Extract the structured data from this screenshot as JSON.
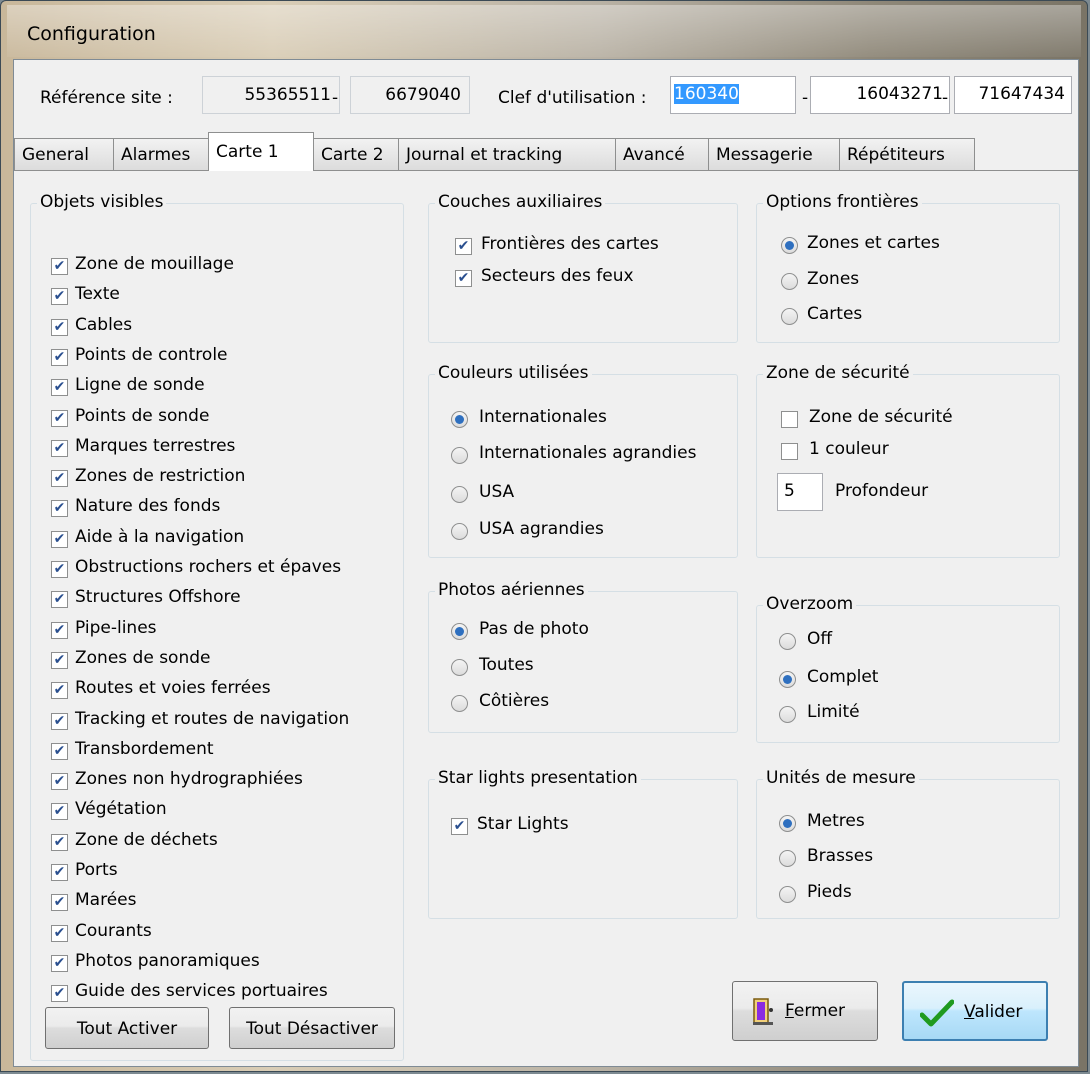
{
  "window": {
    "title": "Configuration"
  },
  "site": {
    "reference_label": "Référence site :",
    "reference_1": "55365511",
    "sep1": "-",
    "reference_2": "6679040",
    "key_label": "Clef d'utilisation :",
    "key_1": "160340",
    "sep2": "-",
    "key_2": "16043271",
    "sep3": "-",
    "key_3": "71647434"
  },
  "tabs": [
    {
      "label": "General"
    },
    {
      "label": "Alarmes"
    },
    {
      "label": "Carte 1"
    },
    {
      "label": "Carte 2"
    },
    {
      "label": "Journal et tracking"
    },
    {
      "label": "Avancé"
    },
    {
      "label": "Messagerie"
    },
    {
      "label": "Répétiteurs"
    }
  ],
  "active_tab": "Carte 1",
  "visible_objects": {
    "title": "Objets visibles",
    "items": [
      {
        "label": "Zone de mouillage",
        "checked": true
      },
      {
        "label": "Texte",
        "checked": true
      },
      {
        "label": "Cables",
        "checked": true
      },
      {
        "label": "Points de controle",
        "checked": true
      },
      {
        "label": "Ligne de sonde",
        "checked": true
      },
      {
        "label": "Points de sonde",
        "checked": true
      },
      {
        "label": "Marques terrestres",
        "checked": true
      },
      {
        "label": "Zones de restriction",
        "checked": true
      },
      {
        "label": "Nature des fonds",
        "checked": true
      },
      {
        "label": "Aide à la navigation",
        "checked": true
      },
      {
        "label": "Obstructions  rochers et épaves",
        "checked": true
      },
      {
        "label": "Structures Offshore",
        "checked": true
      },
      {
        "label": "Pipe-lines",
        "checked": true
      },
      {
        "label": "Zones de sonde",
        "checked": true
      },
      {
        "label": "Routes et voies ferrées",
        "checked": true
      },
      {
        "label": "Tracking et routes de navigation",
        "checked": true
      },
      {
        "label": "Transbordement",
        "checked": true
      },
      {
        "label": "Zones non hydrographiées",
        "checked": true
      },
      {
        "label": "Végétation",
        "checked": true
      },
      {
        "label": "Zone de déchets",
        "checked": true
      },
      {
        "label": "Ports",
        "checked": true
      },
      {
        "label": "Marées",
        "checked": true
      },
      {
        "label": "Courants",
        "checked": true
      },
      {
        "label": "Photos panoramiques",
        "checked": true
      },
      {
        "label": "Guide des services portuaires",
        "checked": true
      }
    ],
    "enable_all": "Tout Activer",
    "disable_all": "Tout Désactiver"
  },
  "aux_layers": {
    "title": "Couches auxiliaires",
    "items": [
      {
        "label": "Frontières des cartes",
        "checked": true
      },
      {
        "label": "Secteurs des feux",
        "checked": true
      }
    ]
  },
  "border_options": {
    "title": "Options frontières",
    "options": [
      "Zones et cartes",
      "Zones",
      "Cartes"
    ],
    "selected": "Zones et cartes"
  },
  "colors_used": {
    "title": "Couleurs utilisées",
    "options": [
      "Internationales",
      "Internationales agrandies",
      "USA",
      "USA agrandies"
    ],
    "selected": "Internationales"
  },
  "safety_zone": {
    "title": "Zone de sécurité",
    "safety_zone_label": "Zone de sécurité",
    "safety_zone_checked": false,
    "one_color_label": "1 couleur",
    "one_color_checked": false,
    "depth_value": "5",
    "depth_label": "Profondeur"
  },
  "aerial_photos": {
    "title": "Photos aériennes",
    "options": [
      "Pas de photo",
      "Toutes",
      "Côtières"
    ],
    "selected": "Pas de photo"
  },
  "overzoom": {
    "title": "Overzoom",
    "options": [
      "Off",
      "Complet",
      "Limité"
    ],
    "selected": "Complet"
  },
  "star_lights": {
    "title": "Star lights presentation",
    "label": "Star Lights",
    "checked": true
  },
  "units": {
    "title": "Unités de mesure",
    "options": [
      "Metres",
      "Brasses",
      "Pieds"
    ],
    "selected": "Metres"
  },
  "buttons": {
    "close_accel": "F",
    "close_rest": "ermer",
    "validate_accel": "V",
    "validate_rest": "alider"
  },
  "colors": {
    "accent": "#2e6fbf",
    "selection": "#3399ff",
    "check": "#1f9a1f"
  }
}
